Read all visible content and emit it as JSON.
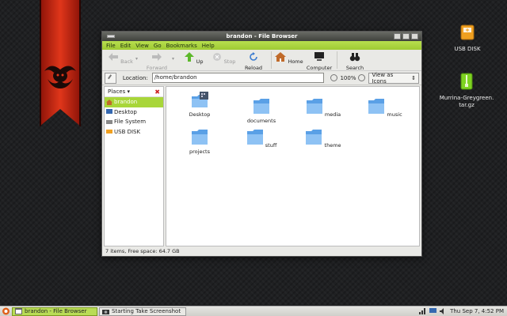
{
  "desktop": {
    "icons": [
      {
        "label": "USB DISK"
      },
      {
        "label": "Murrina-Greygreen.",
        "label2": "tar.gz"
      }
    ]
  },
  "window": {
    "title": "brandon - File Browser",
    "menu": [
      "File",
      "Edit",
      "View",
      "Go",
      "Bookmarks",
      "Help"
    ],
    "toolbar": {
      "back": "Back",
      "forward": "Forward",
      "up": "Up",
      "stop": "Stop",
      "reload": "Reload",
      "home": "Home",
      "computer": "Computer",
      "search": "Search"
    },
    "location": {
      "label": "Location:",
      "value": "/home/brandon",
      "zoom": "100%",
      "view_mode": "View as Icons"
    },
    "sidebar": {
      "header": "Places",
      "items": [
        "brandon",
        "Desktop",
        "File System",
        "USB DISK"
      ]
    },
    "files": [
      "Desktop",
      "documents",
      "media",
      "music",
      "projects",
      "stuff",
      "theme"
    ],
    "status": "7 items, Free space: 64.7 GB"
  },
  "panel": {
    "tasks": [
      "brandon - File Browser",
      "Starting Take Screenshot"
    ],
    "clock": "Thu Sep  7,  4:52 PM"
  },
  "colors": {
    "accent_green": "#a8d63a",
    "folder_blue": "#5aa0e6",
    "ribbon_red": "#d22a14"
  }
}
